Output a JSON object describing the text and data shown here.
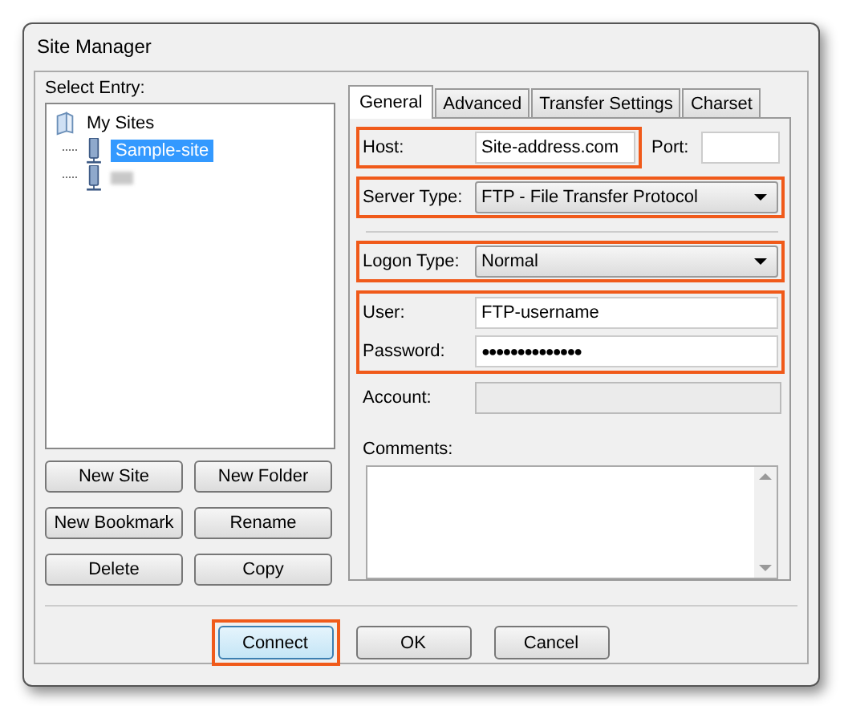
{
  "window": {
    "title": "Site Manager"
  },
  "select_entry": {
    "label": "Select Entry:"
  },
  "tree": [
    {
      "label": "My Sites",
      "kind": "folder",
      "selected": false,
      "children": [
        {
          "label": "Sample-site",
          "kind": "site",
          "selected": true
        },
        {
          "kind": "site-obscured",
          "selected": false
        }
      ]
    }
  ],
  "entry_buttons": [
    "New Site",
    "New Folder",
    "New Bookmark",
    "Rename",
    "Delete",
    "Copy"
  ],
  "tabs": [
    {
      "label": "General",
      "selected": true
    },
    {
      "label": "Advanced",
      "selected": false
    },
    {
      "label": "Transfer Settings",
      "selected": false
    },
    {
      "label": "Charset",
      "selected": false
    }
  ],
  "host": {
    "label": "Host:",
    "value": "Site-address.com",
    "highlighted": true
  },
  "port": {
    "label": "Port:"
  },
  "server_type": {
    "label": "Server Type:",
    "value": "FTP - File Transfer Protocol",
    "highlighted": true
  },
  "logon_type": {
    "label": "Logon Type:",
    "value": "Normal",
    "highlighted": true
  },
  "credentials": {
    "highlighted": true,
    "user": {
      "label": "User:",
      "value": "FTP-username"
    },
    "password": {
      "label": "Password:",
      "value": "●●●●●●●●●●●●●●"
    }
  },
  "account": {
    "label": "Account:",
    "disabled": true
  },
  "comments": {
    "label": "Comments:"
  },
  "buttons": [
    {
      "label": "Connect",
      "highlighted": true
    },
    {
      "label": "OK",
      "highlighted": false
    },
    {
      "label": "Cancel",
      "highlighted": false
    }
  ]
}
